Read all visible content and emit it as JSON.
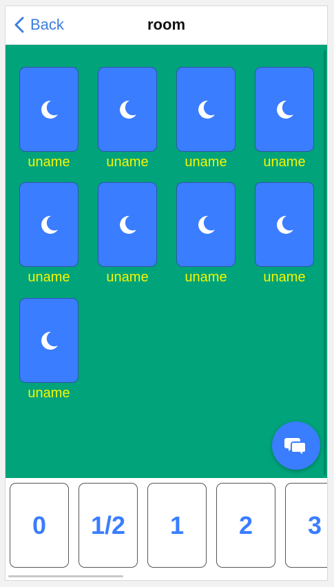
{
  "nav": {
    "back_label": "Back",
    "title": "room"
  },
  "players": [
    {
      "name": "uname",
      "icon": "moon-icon"
    },
    {
      "name": "uname",
      "icon": "moon-icon"
    },
    {
      "name": "uname",
      "icon": "moon-icon"
    },
    {
      "name": "uname",
      "icon": "moon-icon"
    },
    {
      "name": "uname",
      "icon": "moon-icon"
    },
    {
      "name": "uname",
      "icon": "moon-icon"
    },
    {
      "name": "uname",
      "icon": "moon-icon"
    },
    {
      "name": "uname",
      "icon": "moon-icon"
    },
    {
      "name": "uname",
      "icon": "moon-icon"
    }
  ],
  "vote_cards": [
    "0",
    "1/2",
    "1",
    "2",
    "3"
  ],
  "chat_button": {
    "icon": "chat-bubbles-icon"
  },
  "colors": {
    "accent": "#3a7dff",
    "table_green": "#00a37a",
    "name_yellow": "#f7f700"
  }
}
